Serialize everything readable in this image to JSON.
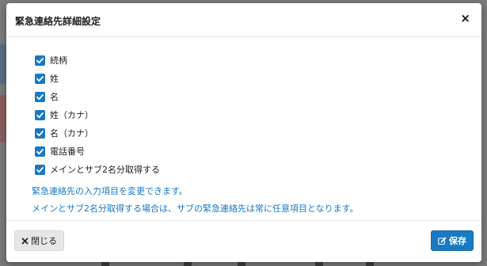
{
  "modal": {
    "title": "緊急連絡先詳細設定",
    "close_glyph": "×"
  },
  "checkboxes": [
    {
      "label": "続柄",
      "checked": true
    },
    {
      "label": "姓",
      "checked": true
    },
    {
      "label": "名",
      "checked": true
    },
    {
      "label": "姓（カナ）",
      "checked": true
    },
    {
      "label": "名（カナ）",
      "checked": true
    },
    {
      "label": "電話番号",
      "checked": true
    },
    {
      "label": "メインとサブ2名分取得する",
      "checked": true
    }
  ],
  "notes": [
    "緊急連絡先の入力項目を変更できます。",
    "メインとサブ2名分取得する場合は、サブの緊急連絡先は常に任意項目となります。"
  ],
  "footer": {
    "close_label": "閉じる",
    "save_label": "保存"
  },
  "colors": {
    "accent": "#1a79c3"
  }
}
